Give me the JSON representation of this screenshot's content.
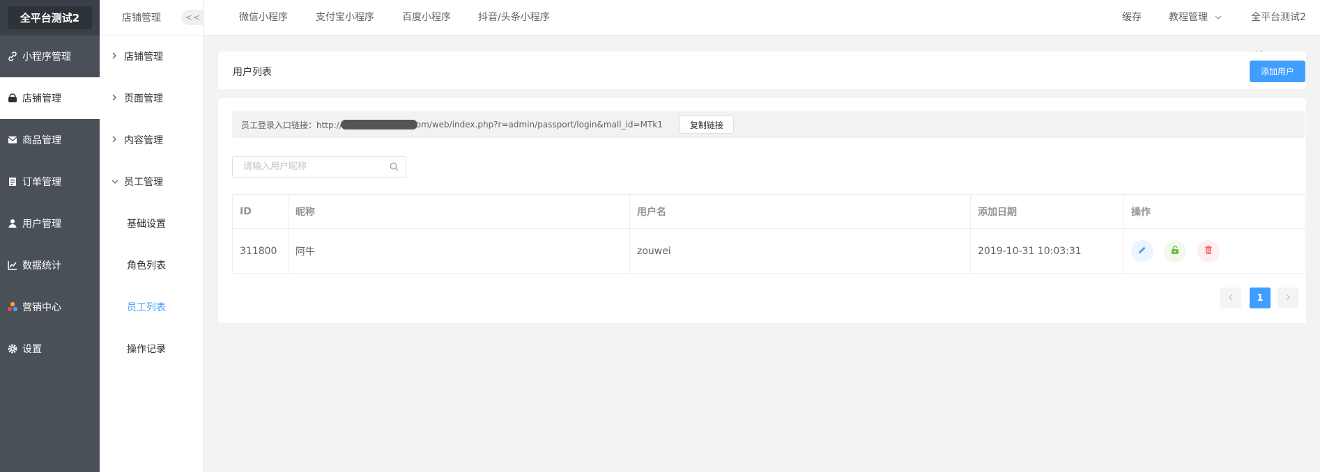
{
  "app": {
    "logo": "全平台测试2"
  },
  "sidebar": {
    "items": [
      {
        "label": "小程序管理",
        "icon": "link-icon"
      },
      {
        "label": "店铺管理",
        "icon": "shop-icon",
        "active": true
      },
      {
        "label": "商品管理",
        "icon": "envelope-icon"
      },
      {
        "label": "订单管理",
        "icon": "list-icon"
      },
      {
        "label": "用户管理",
        "icon": "user-icon"
      },
      {
        "label": "数据统计",
        "icon": "chart-icon"
      },
      {
        "label": "营销中心",
        "icon": "marketing-icon"
      },
      {
        "label": "设置",
        "icon": "gear-icon"
      }
    ]
  },
  "subsidebar": {
    "header": "店铺管理",
    "collapse_label": "<<",
    "groups": [
      {
        "label": "店铺管理"
      },
      {
        "label": "页面管理"
      },
      {
        "label": "内容管理"
      },
      {
        "label": "员工管理"
      }
    ],
    "children": [
      {
        "label": "基础设置"
      },
      {
        "label": "角色列表"
      },
      {
        "label": "员工列表",
        "active": true
      },
      {
        "label": "操作记录"
      }
    ]
  },
  "topnav": {
    "tabs": [
      "微信小程序",
      "支付宝小程序",
      "百度小程序",
      "抖音/头条小程序"
    ],
    "cache": "缓存",
    "tutorial": "教程管理",
    "account": "全平台测试2"
  },
  "header_card": {
    "title": "用户列表",
    "add_button": "添加用户"
  },
  "link_bar": {
    "label": "员工登录入口链接：http://",
    "url_suffix": "om/web/index.php?r=admin/passport/login&mall_id=MTk1",
    "copy_button": "复制链接"
  },
  "search": {
    "placeholder": "请输入用户昵称"
  },
  "table": {
    "headers": [
      "ID",
      "昵称",
      "用户名",
      "添加日期",
      "操作"
    ],
    "rows": [
      {
        "id": "311800",
        "nickname": "阿牛",
        "username": "zouwei",
        "date": "2019-10-31 10:03:31"
      }
    ]
  },
  "pagination": {
    "current": "1"
  },
  "colors": {
    "primary": "#409eff",
    "sidebar_bg": "#4a5058",
    "edit": "#409eff",
    "unlock": "#67c23a",
    "delete": "#f56c6c"
  }
}
